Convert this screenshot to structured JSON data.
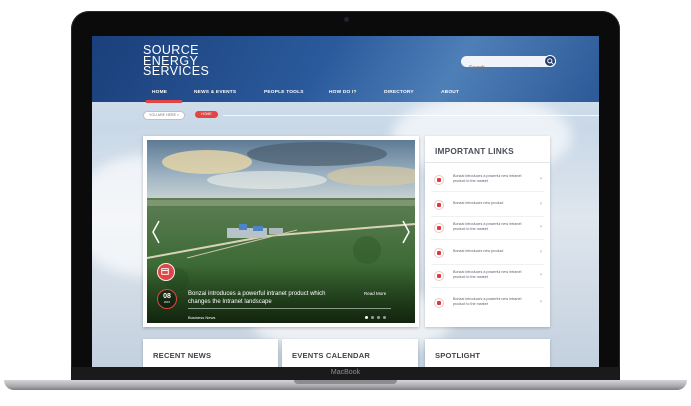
{
  "device": {
    "brand_label": "MacBook"
  },
  "logo": {
    "line1": "SOURCE",
    "line2": "ENERGY",
    "line3": "SERVICES"
  },
  "search": {
    "placeholder": "Search"
  },
  "nav": {
    "items": [
      {
        "label": "HOME",
        "active": true
      },
      {
        "label": "NEWS & EVENTS"
      },
      {
        "label": "PEOPLE TOOLS"
      },
      {
        "label": "HOW DO I?"
      },
      {
        "label": "DIRECTORY"
      },
      {
        "label": "ABOUT"
      }
    ]
  },
  "breadcrumb": {
    "prefix": "YOU ARE HERE >",
    "current": "HOME"
  },
  "hero": {
    "title": "Bonzai introduces a powerful intranet product which changes the Intranet landscape",
    "read_more": "Read More",
    "category": "Business News",
    "date_day": "08",
    "date_year": "2015"
  },
  "important_links": {
    "title": "IMPORTANT LINKS",
    "items": [
      {
        "text": "Bonzai introduces a powerful new intranet product to the market",
        "icon": "car-icon"
      },
      {
        "text": "Bonzai introduces new product",
        "icon": "tag-icon"
      },
      {
        "text": "Bonzai introduces a powerful new intranet product to the market",
        "icon": "briefcase-icon"
      },
      {
        "text": "Bonzai introduces new product",
        "icon": "person-icon"
      },
      {
        "text": "Bonzai introduces a powerful new intranet product to the market",
        "icon": "tag-icon"
      },
      {
        "text": "Bonzai introduces a powerful new intranet product to the market",
        "icon": "briefcase-icon"
      }
    ]
  },
  "cards": {
    "recent_news": "RECENT NEWS",
    "events_calendar": "EVENTS CALENDAR",
    "spotlight": "SPOTLIGHT"
  },
  "colors": {
    "brand_blue": "#1f4380",
    "accent_red": "#e04646"
  }
}
